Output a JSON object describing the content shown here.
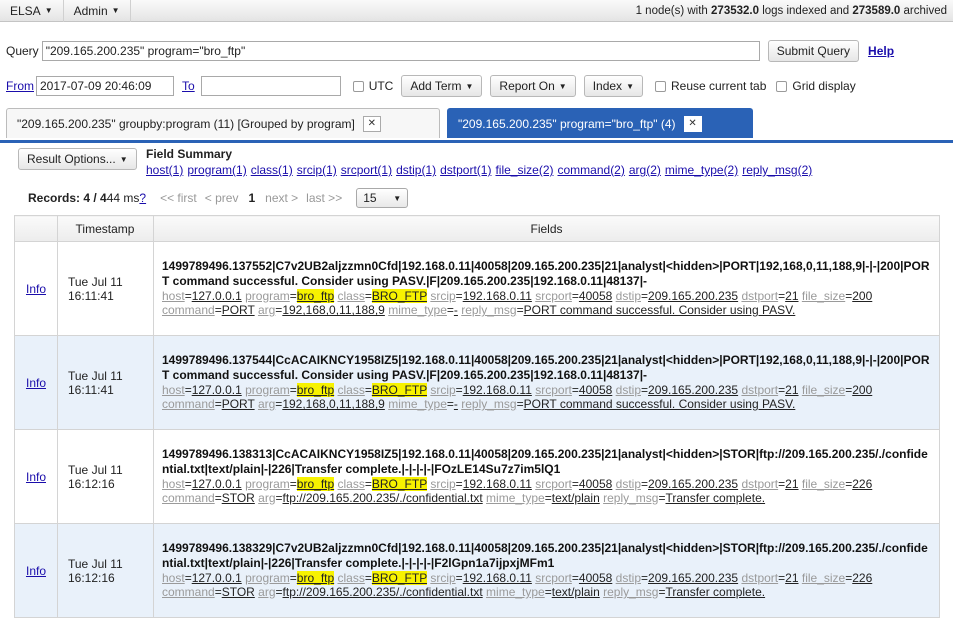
{
  "nav": {
    "menu1": "ELSA",
    "menu2": "Admin",
    "status_pre": "1 node(s) with ",
    "logs_indexed": "273532.0",
    "status_mid": " logs indexed and ",
    "archived": "273589.0",
    "status_post": " archived"
  },
  "query": {
    "label": "Query",
    "value": "\"209.165.200.235\" program=\"bro_ftp\"",
    "submit": "Submit Query",
    "help": "Help"
  },
  "time": {
    "from_label": "From",
    "from_value": "2017-07-09 20:46:09",
    "to_label": "To",
    "to_value": "",
    "utc": "UTC",
    "add_term": "Add Term",
    "report_on": "Report On",
    "index": "Index",
    "reuse_tab": "Reuse current tab",
    "grid_display": "Grid display"
  },
  "tabs": [
    {
      "label": "\"209.165.200.235\" groupby:program (11) [Grouped by program]",
      "active": false
    },
    {
      "label": "\"209.165.200.235\" program=\"bro_ftp\" (4)",
      "active": true
    }
  ],
  "summary": {
    "result_options": "Result Options...",
    "title": "Field Summary",
    "fields": [
      "host(1)",
      "program(1)",
      "class(1)",
      "srcip(1)",
      "srcport(1)",
      "dstip(1)",
      "dstport(1)",
      "file_size(2)",
      "command(2)",
      "arg(2)",
      "mime_type(2)",
      "reply_msg(2)"
    ]
  },
  "records": {
    "label": "Records: 4 / 4",
    "ms": " 44 ms ",
    "help": "?",
    "first": "<< first",
    "prev": "< prev",
    "page": "1",
    "next": "next >",
    "last": "last >>",
    "page_size": "15"
  },
  "table": {
    "headers": [
      "",
      "Timestamp",
      "Fields"
    ],
    "info_label": "Info",
    "rows": [
      {
        "date": "Tue Jul 11",
        "time": "16:11:41",
        "raw": "1499789496.137552|C7v2UB2aljzzmn0Cfd|192.168.0.11|40058|209.165.200.235|21|analyst|<hidden>|PORT|192,168,0,11,188,9|-|-|200|PORT command successful. Consider using PASV.|F|209.165.200.235|192.168.0.11|48137|-",
        "fields": [
          {
            "k": "host",
            "v": "127.0.0.1"
          },
          {
            "k": "program",
            "v": "bro_ftp",
            "hl": true
          },
          {
            "k": "class",
            "v": "BRO_FTP",
            "hl": true
          },
          {
            "k": "srcip",
            "v": "192.168.0.11"
          },
          {
            "k": "srcport",
            "v": "40058"
          },
          {
            "k": "dstip",
            "v": "209.165.200.235"
          },
          {
            "k": "dstport",
            "v": "21"
          },
          {
            "k": "file_size",
            "v": "200"
          },
          {
            "k": "command",
            "v": "PORT"
          },
          {
            "k": "arg",
            "v": "192,168,0,11,188,9"
          },
          {
            "k": "mime_type",
            "v": "-"
          },
          {
            "k": "reply_msg",
            "v": "PORT command successful. Consider using PASV."
          }
        ]
      },
      {
        "date": "Tue Jul 11",
        "time": "16:11:41",
        "raw": "1499789496.137544|CcACAIKNCY1958IZ5|192.168.0.11|40058|209.165.200.235|21|analyst|<hidden>|PORT|192,168,0,11,188,9|-|-|200|PORT command successful. Consider using PASV.|F|209.165.200.235|192.168.0.11|48137|-",
        "fields": [
          {
            "k": "host",
            "v": "127.0.0.1"
          },
          {
            "k": "program",
            "v": "bro_ftp",
            "hl": true
          },
          {
            "k": "class",
            "v": "BRO_FTP",
            "hl": true
          },
          {
            "k": "srcip",
            "v": "192.168.0.11"
          },
          {
            "k": "srcport",
            "v": "40058"
          },
          {
            "k": "dstip",
            "v": "209.165.200.235"
          },
          {
            "k": "dstport",
            "v": "21"
          },
          {
            "k": "file_size",
            "v": "200"
          },
          {
            "k": "command",
            "v": "PORT"
          },
          {
            "k": "arg",
            "v": "192,168,0,11,188,9"
          },
          {
            "k": "mime_type",
            "v": "-"
          },
          {
            "k": "reply_msg",
            "v": "PORT command successful. Consider using PASV."
          }
        ]
      },
      {
        "date": "Tue Jul 11",
        "time": "16:12:16",
        "raw": "1499789496.138313|CcACAIKNCY1958IZ5|192.168.0.11|40058|209.165.200.235|21|analyst|<hidden>|STOR|ftp://209.165.200.235/./confidential.txt|text/plain|-|226|Transfer complete.|-|-|-|-|FOzLE14Su7z7im5lQ1",
        "fields": [
          {
            "k": "host",
            "v": "127.0.0.1"
          },
          {
            "k": "program",
            "v": "bro_ftp",
            "hl": true
          },
          {
            "k": "class",
            "v": "BRO_FTP",
            "hl": true
          },
          {
            "k": "srcip",
            "v": "192.168.0.11"
          },
          {
            "k": "srcport",
            "v": "40058"
          },
          {
            "k": "dstip",
            "v": "209.165.200.235"
          },
          {
            "k": "dstport",
            "v": "21"
          },
          {
            "k": "file_size",
            "v": "226"
          },
          {
            "k": "command",
            "v": "STOR"
          },
          {
            "k": "arg",
            "v": "ftp://209.165.200.235/./confidential.txt"
          },
          {
            "k": "mime_type",
            "v": "text/plain"
          },
          {
            "k": "reply_msg",
            "v": "Transfer complete."
          }
        ]
      },
      {
        "date": "Tue Jul 11",
        "time": "16:12:16",
        "raw": "1499789496.138329|C7v2UB2aljzzmn0Cfd|192.168.0.11|40058|209.165.200.235|21|analyst|<hidden>|STOR|ftp://209.165.200.235/./confidential.txt|text/plain|-|226|Transfer complete.|-|-|-|-|F2lGpn1a7ijpxjMFm1",
        "fields": [
          {
            "k": "host",
            "v": "127.0.0.1"
          },
          {
            "k": "program",
            "v": "bro_ftp",
            "hl": true
          },
          {
            "k": "class",
            "v": "BRO_FTP",
            "hl": true
          },
          {
            "k": "srcip",
            "v": "192.168.0.11"
          },
          {
            "k": "srcport",
            "v": "40058"
          },
          {
            "k": "dstip",
            "v": "209.165.200.235"
          },
          {
            "k": "dstport",
            "v": "21"
          },
          {
            "k": "file_size",
            "v": "226"
          },
          {
            "k": "command",
            "v": "STOR"
          },
          {
            "k": "arg",
            "v": "ftp://209.165.200.235/./confidential.txt"
          },
          {
            "k": "mime_type",
            "v": "text/plain"
          },
          {
            "k": "reply_msg",
            "v": "Transfer complete."
          }
        ]
      }
    ]
  }
}
